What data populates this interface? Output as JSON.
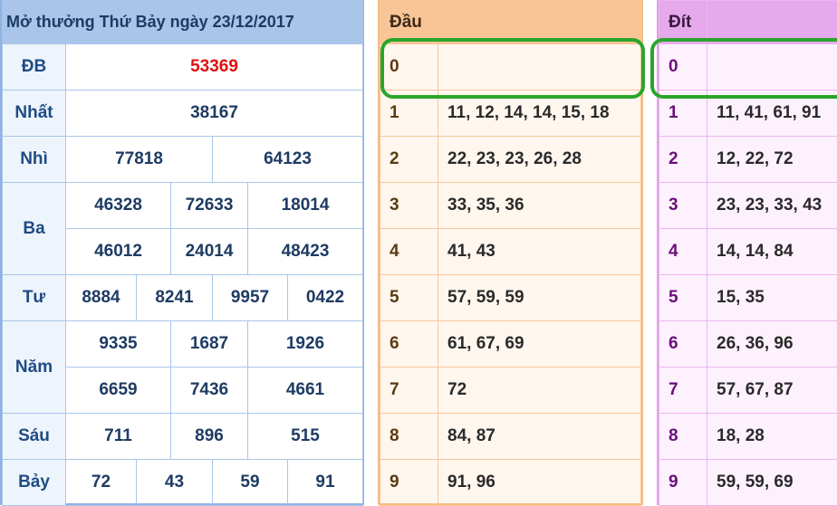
{
  "results": {
    "title": "Mở thưởng Thứ Bảy ngày 23/12/2017",
    "db": {
      "label": "ĐB",
      "value": "53369"
    },
    "nhat": {
      "label": "Nhất",
      "value": "38167"
    },
    "nhi": {
      "label": "Nhì",
      "values": [
        "77818",
        "64123"
      ]
    },
    "ba": {
      "label": "Ba",
      "values": [
        "46328",
        "72633",
        "18014",
        "46012",
        "24014",
        "48423"
      ]
    },
    "tu": {
      "label": "Tư",
      "values": [
        "8884",
        "8241",
        "9957",
        "0422"
      ]
    },
    "nam": {
      "label": "Năm",
      "values": [
        "9335",
        "1687",
        "1926",
        "6659",
        "7436",
        "4661"
      ]
    },
    "sau": {
      "label": "Sáu",
      "values": [
        "711",
        "896",
        "515"
      ]
    },
    "bay": {
      "label": "Bảy",
      "values": [
        "72",
        "43",
        "59",
        "91"
      ]
    }
  },
  "dau": {
    "title": "Đầu",
    "rows": [
      {
        "head": "0",
        "values": ""
      },
      {
        "head": "1",
        "values": "11, 12, 14, 14, 15, 18"
      },
      {
        "head": "2",
        "values": "22, 23, 23, 26, 28"
      },
      {
        "head": "3",
        "values": "33, 35, 36"
      },
      {
        "head": "4",
        "values": "41, 43"
      },
      {
        "head": "5",
        "values": "57, 59, 59"
      },
      {
        "head": "6",
        "values": "61, 67, 69"
      },
      {
        "head": "7",
        "values": "72"
      },
      {
        "head": "8",
        "values": "84, 87"
      },
      {
        "head": "9",
        "values": "91, 96"
      }
    ]
  },
  "dit": {
    "title": "Đít",
    "rows": [
      {
        "tail": "0",
        "values": ""
      },
      {
        "tail": "1",
        "values": "11, 41, 61, 91"
      },
      {
        "tail": "2",
        "values": "12, 22, 72"
      },
      {
        "tail": "3",
        "values": "23, 23, 33, 43"
      },
      {
        "tail": "4",
        "values": "14, 14, 84"
      },
      {
        "tail": "5",
        "values": "15, 35"
      },
      {
        "tail": "6",
        "values": "26, 36, 96"
      },
      {
        "tail": "7",
        "values": "57, 67, 87"
      },
      {
        "tail": "8",
        "values": "18, 28"
      },
      {
        "tail": "9",
        "values": "59, 59, 69"
      }
    ]
  },
  "colors": {
    "special_prize": "#e01010",
    "highlight_ring": "#2aa52a",
    "results_header": "#a9c6ea",
    "dau_header": "#f9c597",
    "dit_header": "#e5a9ec"
  }
}
